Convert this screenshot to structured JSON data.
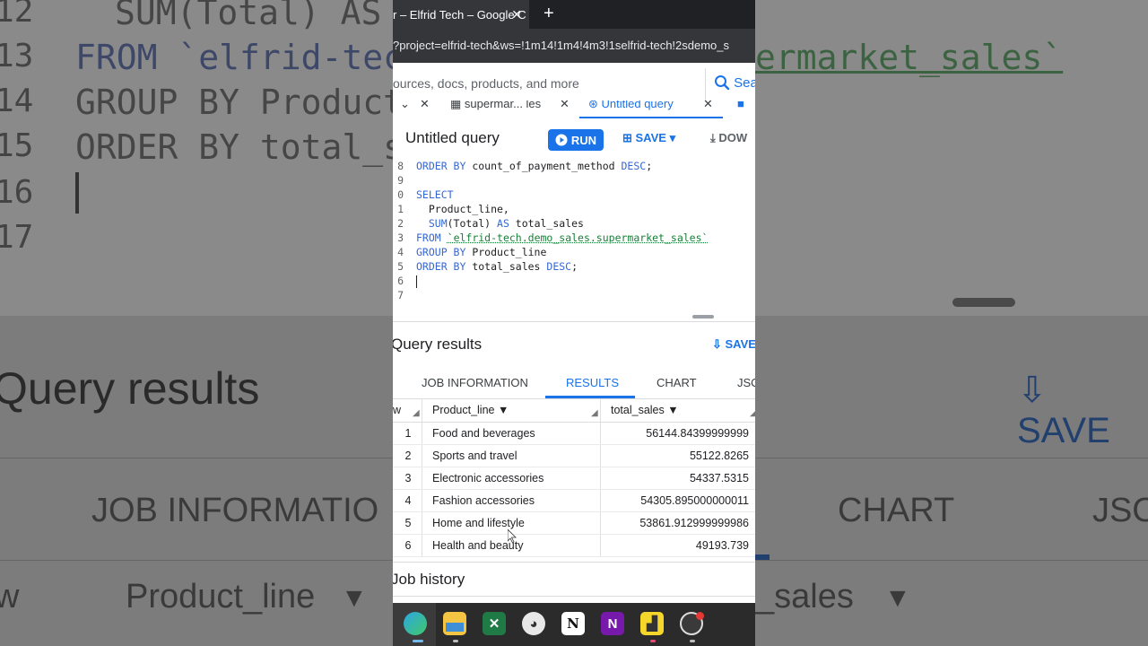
{
  "background": {
    "code_lines": [
      {
        "num": "12",
        "text": "SUM(Total) AS"
      },
      {
        "num": "13",
        "text": "FROM `elfrid-tech",
        "suffix": "ermarket_sales`"
      },
      {
        "num": "14",
        "text": "GROUP BY Product_"
      },
      {
        "num": "15",
        "text": "ORDER BY total_s"
      },
      {
        "num": "16",
        "text": ""
      },
      {
        "num": "17",
        "text": ""
      }
    ],
    "query_results": "Query results",
    "save": "SAVE",
    "tabs": [
      "JOB INFORMATIO",
      "CHART",
      "JSO"
    ],
    "columns": [
      "w",
      "Product_line",
      "_sales"
    ]
  },
  "browser": {
    "tab_title": "r – Elfrid Tech – Google C",
    "url": "?project=elfrid-tech&ws=!1m14!1m4!4m3!1selfrid-tech!2sdemo_s"
  },
  "search": {
    "placeholder": "ources, docs, products, and more",
    "button": "Sea"
  },
  "editor_tabs": [
    "supermar... les",
    "Untitled query"
  ],
  "query": {
    "title": "Untitled query",
    "run": "RUN",
    "save": "SAVE",
    "download": "DOW"
  },
  "code": [
    {
      "num": "8",
      "parts": [
        {
          "t": "ORDER BY",
          "c": "kw"
        },
        {
          "t": " count_of_payment_method ",
          "c": ""
        },
        {
          "t": "DESC",
          "c": "kw"
        },
        {
          "t": ";",
          "c": ""
        }
      ]
    },
    {
      "num": "9",
      "parts": []
    },
    {
      "num": "0",
      "parts": [
        {
          "t": "SELECT",
          "c": "kw"
        }
      ]
    },
    {
      "num": "1",
      "parts": [
        {
          "t": "  Product_line,",
          "c": ""
        }
      ]
    },
    {
      "num": "2",
      "parts": [
        {
          "t": "  SUM",
          "c": "kw"
        },
        {
          "t": "(Total) ",
          "c": ""
        },
        {
          "t": "AS",
          "c": "kw"
        },
        {
          "t": " total_sales",
          "c": ""
        }
      ]
    },
    {
      "num": "3",
      "parts": [
        {
          "t": "FROM",
          "c": "kw"
        },
        {
          "t": " ",
          "c": ""
        },
        {
          "t": "`elfrid-tech.demo_sales.supermarket_sales`",
          "c": "str"
        }
      ]
    },
    {
      "num": "4",
      "parts": [
        {
          "t": "GROUP BY",
          "c": "kw"
        },
        {
          "t": " Product_line",
          "c": ""
        }
      ]
    },
    {
      "num": "5",
      "parts": [
        {
          "t": "ORDER BY",
          "c": "kw"
        },
        {
          "t": " total_sales ",
          "c": ""
        },
        {
          "t": "DESC",
          "c": "kw"
        },
        {
          "t": ";",
          "c": ""
        }
      ]
    },
    {
      "num": "6",
      "parts": []
    },
    {
      "num": "7",
      "parts": []
    }
  ],
  "results": {
    "title": "Query results",
    "save": "SAVE",
    "tabs": [
      "JOB INFORMATION",
      "RESULTS",
      "CHART",
      "JSO"
    ],
    "active_tab": "RESULTS",
    "columns": {
      "row": "w",
      "product_line": "Product_line",
      "total_sales": "total_sales"
    },
    "rows": [
      {
        "idx": "1",
        "product_line": "Food and beverages",
        "total_sales": "56144.84399999999"
      },
      {
        "idx": "2",
        "product_line": "Sports and travel",
        "total_sales": "55122.8265"
      },
      {
        "idx": "3",
        "product_line": "Electronic accessories",
        "total_sales": "54337.5315"
      },
      {
        "idx": "4",
        "product_line": "Fashion accessories",
        "total_sales": "54305.895000000011"
      },
      {
        "idx": "5",
        "product_line": "Home and lifestyle",
        "total_sales": "53861.912999999986"
      },
      {
        "idx": "6",
        "product_line": "Health and beauty",
        "total_sales": "49193.739"
      }
    ]
  },
  "job_history": "Job history",
  "taskbar": {
    "icons": [
      "edge-icon",
      "file-explorer-icon",
      "excel-icon",
      "paint-icon",
      "notion-icon",
      "onenote-icon",
      "sticky-notes-icon",
      "obs-icon"
    ],
    "notion_letter": "N",
    "onenote_letter": "N"
  },
  "colors": {
    "accent": "#1a73e8",
    "keyword": "#3367d6",
    "string": "#188038"
  }
}
